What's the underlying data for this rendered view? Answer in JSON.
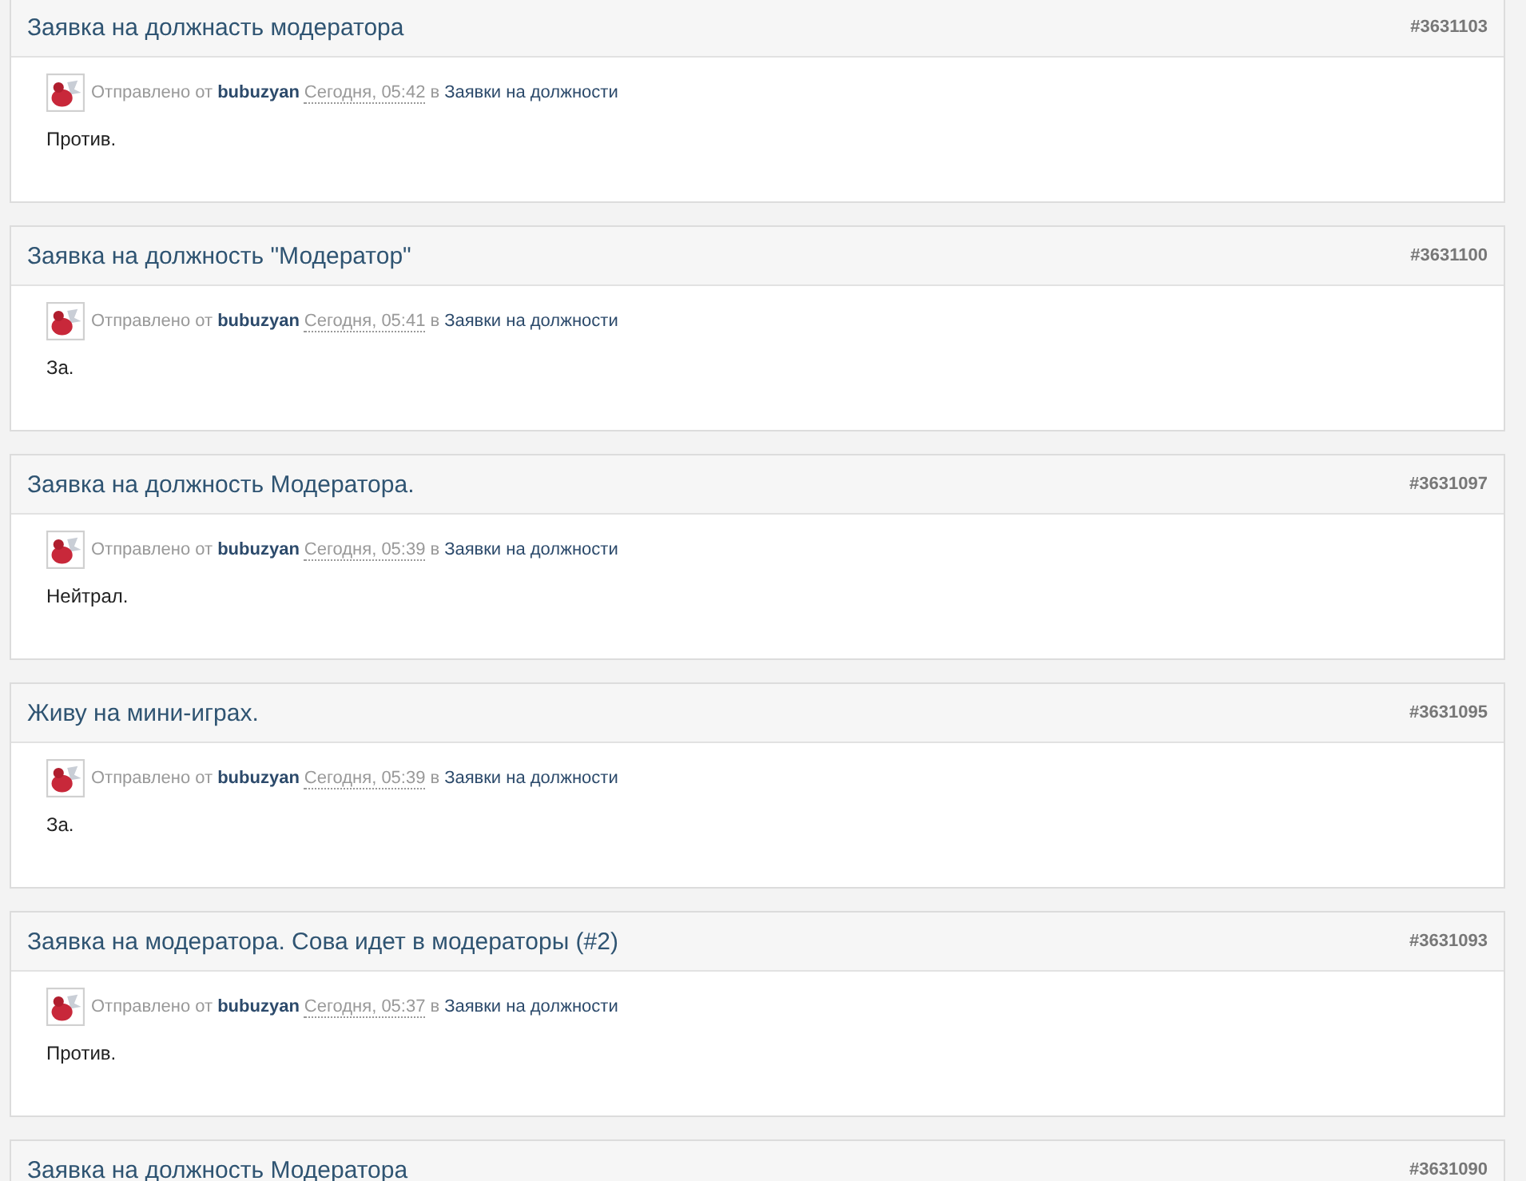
{
  "posts": [
    {
      "title": "Заявка на должнасть модератора",
      "number": "#3631103",
      "meta": {
        "sent_label": "Отправлено от",
        "author": "bubuzyan",
        "date": "Сегодня, 05:42",
        "in_label": "в",
        "forum": "Заявки на должности"
      },
      "text": "Против."
    },
    {
      "title": "Заявка на должность \"Модератор\"",
      "number": "#3631100",
      "meta": {
        "sent_label": "Отправлено от",
        "author": "bubuzyan",
        "date": "Сегодня, 05:41",
        "in_label": "в",
        "forum": "Заявки на должности"
      },
      "text": "За."
    },
    {
      "title": "Заявка на должность Модератора.",
      "number": "#3631097",
      "meta": {
        "sent_label": "Отправлено от",
        "author": "bubuzyan",
        "date": "Сегодня, 05:39",
        "in_label": "в",
        "forum": "Заявки на должности"
      },
      "text": "Нейтрал."
    },
    {
      "title": "Живу на мини-играх.",
      "number": "#3631095",
      "meta": {
        "sent_label": "Отправлено от",
        "author": "bubuzyan",
        "date": "Сегодня, 05:39",
        "in_label": "в",
        "forum": "Заявки на должности"
      },
      "text": "За."
    },
    {
      "title": "Заявка на модератора. Сова идет в модераторы (#2)",
      "number": "#3631093",
      "meta": {
        "sent_label": "Отправлено от",
        "author": "bubuzyan",
        "date": "Сегодня, 05:37",
        "in_label": "в",
        "forum": "Заявки на должности"
      },
      "text": "Против."
    },
    {
      "title": "Заявка на должность Модератора",
      "number": "#3631090"
    }
  ]
}
